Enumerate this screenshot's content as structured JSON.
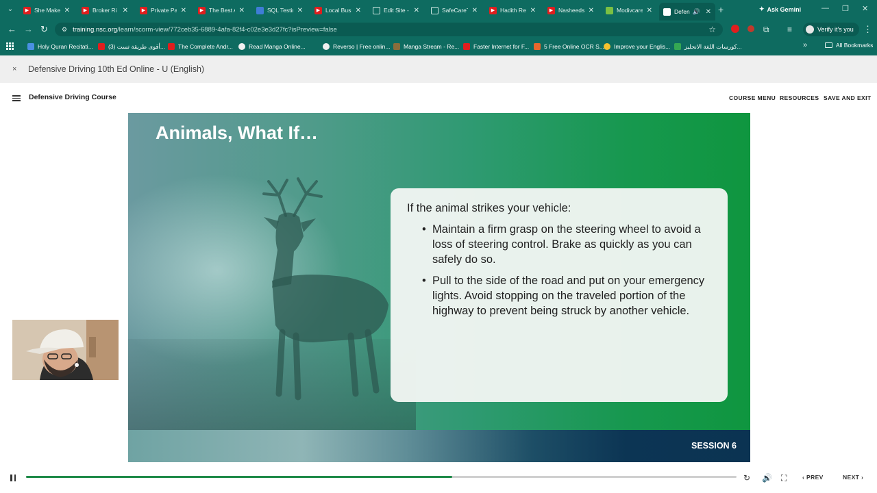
{
  "browser": {
    "tabs": [
      {
        "label": "She Makes",
        "icon": "youtube-icon"
      },
      {
        "label": "Broker Ri",
        "icon": "youtube-icon"
      },
      {
        "label": "Private Pa",
        "icon": "youtube-icon"
      },
      {
        "label": "The Best A",
        "icon": "youtube-icon"
      },
      {
        "label": "SQL Testin",
        "icon": "sql-icon"
      },
      {
        "label": "Local Busi",
        "icon": "youtube-icon"
      },
      {
        "label": "Edit Site -",
        "icon": "globe-icon"
      },
      {
        "label": "SafeCareT",
        "icon": "globe-icon"
      },
      {
        "label": "Hadith Re",
        "icon": "youtube-icon"
      },
      {
        "label": "Nasheeds",
        "icon": "youtube-icon"
      },
      {
        "label": "Modivcare",
        "icon": "grid-icon"
      },
      {
        "label": "Defen",
        "icon": "nsc-icon"
      }
    ],
    "tab_close_glyph": "✕",
    "new_tab_glyph": "+",
    "gemini_label": "Ask Gemini",
    "url_host": "training.nsc.org",
    "url_path": "/learn/scorm-view/772ceb35-6889-4afa-82f4-c02e3e3d27fc?isPreview=false",
    "verify_label": "Verify it's you",
    "bookmarks": [
      {
        "label": "Holy Quran Recitati...",
        "color": "#4a90e2"
      },
      {
        "label": "(3) أقوى طريقة تست...",
        "color": "#e01e1e"
      },
      {
        "label": "The Complete Andr...",
        "color": "#e01e1e"
      },
      {
        "label": "Read Manga Online...",
        "color": "#f0f0f0"
      },
      {
        "label": "Reverso | Free onlin...",
        "color": "#f0f0f0"
      },
      {
        "label": "Manga Stream - Re...",
        "color": "#8a6d3b"
      },
      {
        "label": "Faster Internet for F...",
        "color": "#e01e1e"
      },
      {
        "label": "5 Free Online OCR S...",
        "color": "#e6672d"
      },
      {
        "label": "Improve your Englis...",
        "color": "#f2c12e"
      },
      {
        "label": "كورسات اللغة الانجليز...",
        "color": "#34a853"
      }
    ],
    "all_bookmarks_label": "All Bookmarks"
  },
  "course": {
    "window_title": "Defensive Driving 10th Ed Online - U (English)",
    "close_glyph": "×",
    "course_name": "Defensive Driving Course",
    "menu": {
      "course_menu": "COURSE MENU",
      "resources": "RESOURCES",
      "save_exit": "SAVE AND EXIT"
    }
  },
  "slide": {
    "title": "Animals, What If…",
    "intro": "If the animal strikes your vehicle:",
    "bullets": [
      "Maintain a firm grasp on the steering wheel to avoid a loss of steering control. Brake as quickly as you can safely do so.",
      "Pull to the side of the road and put on your emergency lights. Avoid stopping on the traveled portion of the highway to prevent being struck by another vehicle."
    ],
    "bullet_glyph": "•",
    "session": "SESSION 6"
  },
  "player": {
    "progress": 0.6,
    "prev_label": "PREV",
    "next_label": "NEXT",
    "accent": "#1e8a48"
  }
}
